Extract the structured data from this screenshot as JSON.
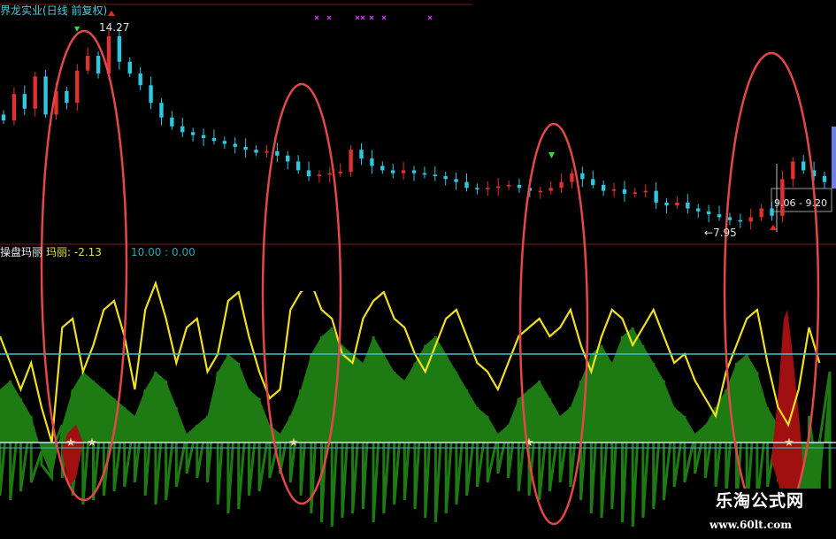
{
  "window": {
    "title": "界龙实业(日线 前复权)",
    "background": "#000000"
  },
  "price_panel": {
    "high_label": "14.27",
    "low_label": "←7.95",
    "range_label": "9.06 - 9.20",
    "up_color": "#e03030",
    "down_color": "#30c8e0"
  },
  "indicator_panel": {
    "name": "操盘玛丽",
    "value_text": "玛丽: -2.13",
    "extra_text": "10.00 : 0.00"
  },
  "watermark": {
    "chinese": "乐淘公式网",
    "url": "www.60lt.com"
  },
  "chart_data": [
    {
      "type": "candlestick",
      "title": "界龙实业(日线 前复权)",
      "annotations": [
        "14.27",
        "←7.95",
        "9.06 - 9.20"
      ],
      "close": [
        11.4,
        12.3,
        11.8,
        12.9,
        11.6,
        12.4,
        12.0,
        13.1,
        13.6,
        13.0,
        14.27,
        13.4,
        13.0,
        12.6,
        12.0,
        11.5,
        11.2,
        11.0,
        10.9,
        10.8,
        10.7,
        10.6,
        10.5,
        10.4,
        10.3,
        10.35,
        10.2,
        10.0,
        9.7,
        9.5,
        9.55,
        9.6,
        9.65,
        10.4,
        10.1,
        9.85,
        9.7,
        9.6,
        9.7,
        9.6,
        9.55,
        9.5,
        9.4,
        9.3,
        9.1,
        9.05,
        9.1,
        9.15,
        9.2,
        9.1,
        9.0,
        9.0,
        9.1,
        9.3,
        9.6,
        9.4,
        9.2,
        9.0,
        9.05,
        8.9,
        8.95,
        9.0,
        8.6,
        8.5,
        8.6,
        8.4,
        8.3,
        8.2,
        8.1,
        8.0,
        7.95,
        8.1,
        8.4,
        8.15,
        9.4,
        10.0,
        9.7,
        9.5,
        9.3
      ],
      "candle_color_meaning": {
        "up": "red",
        "down": "cyan"
      }
    },
    {
      "type": "area",
      "title": "操盘玛丽",
      "annotations": [
        "玛丽: -2.13",
        "10.00 : 0.00"
      ],
      "ylim": [
        -10,
        20
      ],
      "series": [
        {
          "values": [
            6,
            7,
            5,
            3,
            -1,
            -4,
            2,
            6,
            8,
            7,
            6,
            5,
            4,
            3,
            6,
            8,
            7,
            4,
            1,
            2,
            3,
            8,
            10,
            9,
            6,
            5,
            2,
            1,
            3,
            6,
            10,
            12,
            13,
            11,
            10,
            9,
            12,
            10,
            8,
            7,
            9,
            11,
            12,
            10,
            8,
            6,
            4,
            3,
            1,
            2,
            5,
            6,
            7,
            5,
            3,
            4,
            7,
            10,
            11,
            9,
            12,
            13,
            11,
            9,
            7,
            4,
            3,
            1,
            2,
            4,
            6,
            9,
            10,
            8,
            4,
            2,
            -2,
            -8,
            -12,
            -6,
            8
          ]
        },
        {
          "values": [
            12,
            9,
            6,
            9,
            4,
            0,
            13,
            14,
            8,
            11,
            15,
            16,
            12,
            6,
            15,
            18,
            14,
            9,
            13,
            14,
            8,
            10,
            16,
            17,
            12,
            8,
            5,
            6,
            15,
            17,
            18,
            15,
            14,
            10,
            9,
            14,
            16,
            17,
            14,
            13,
            10,
            8,
            11,
            14,
            15,
            12,
            9,
            8,
            6,
            9,
            12,
            13,
            14,
            12,
            13,
            15,
            11,
            8,
            12,
            15,
            14,
            11,
            13,
            15,
            12,
            9,
            10,
            7,
            5,
            3,
            8,
            11,
            14,
            15,
            9,
            4,
            2,
            6,
            13,
            9
          ]
        }
      ]
    }
  ]
}
